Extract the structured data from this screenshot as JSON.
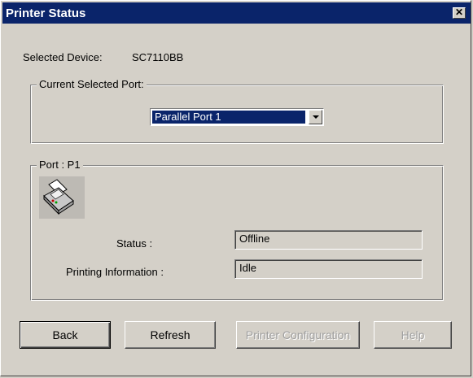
{
  "window": {
    "title": "Printer Status",
    "close_label": "✕"
  },
  "device": {
    "label": "Selected Device:",
    "value": "SC7110BB"
  },
  "port_group": {
    "legend": "Current Selected Port:",
    "selected": "Parallel Port 1"
  },
  "status_group": {
    "legend": "Port : P1",
    "icon": "printer-icon",
    "status_label": "Status :",
    "status_value": "Offline",
    "printing_label": "Printing Information :",
    "printing_value": "Idle"
  },
  "buttons": {
    "back": "Back",
    "refresh": "Refresh",
    "printer_configuration": "Printer Configuration",
    "help": "Help"
  },
  "colors": {
    "titlebar": "#0a246a",
    "face": "#d4d0c8",
    "selection": "#0a246a"
  }
}
